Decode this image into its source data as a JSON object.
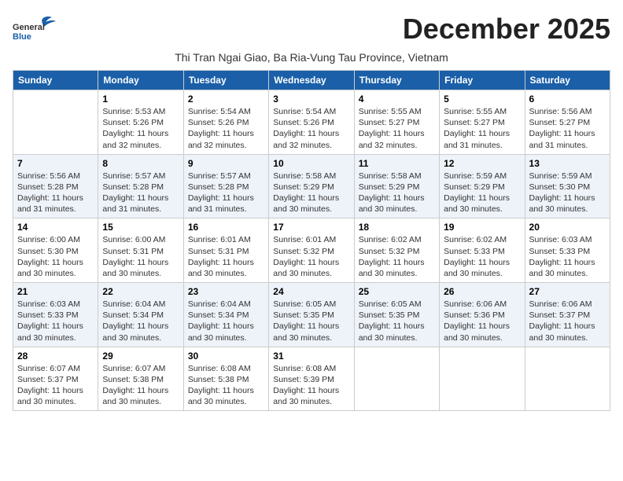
{
  "header": {
    "logo_general": "General",
    "logo_blue": "Blue",
    "month_title": "December 2025",
    "subtitle": "Thi Tran Ngai Giao, Ba Ria-Vung Tau Province, Vietnam"
  },
  "weekdays": [
    "Sunday",
    "Monday",
    "Tuesday",
    "Wednesday",
    "Thursday",
    "Friday",
    "Saturday"
  ],
  "weeks": [
    [
      {
        "day": "",
        "info": ""
      },
      {
        "day": "1",
        "info": "Sunrise: 5:53 AM\nSunset: 5:26 PM\nDaylight: 11 hours\nand 32 minutes."
      },
      {
        "day": "2",
        "info": "Sunrise: 5:54 AM\nSunset: 5:26 PM\nDaylight: 11 hours\nand 32 minutes."
      },
      {
        "day": "3",
        "info": "Sunrise: 5:54 AM\nSunset: 5:26 PM\nDaylight: 11 hours\nand 32 minutes."
      },
      {
        "day": "4",
        "info": "Sunrise: 5:55 AM\nSunset: 5:27 PM\nDaylight: 11 hours\nand 32 minutes."
      },
      {
        "day": "5",
        "info": "Sunrise: 5:55 AM\nSunset: 5:27 PM\nDaylight: 11 hours\nand 31 minutes."
      },
      {
        "day": "6",
        "info": "Sunrise: 5:56 AM\nSunset: 5:27 PM\nDaylight: 11 hours\nand 31 minutes."
      }
    ],
    [
      {
        "day": "7",
        "info": "Sunrise: 5:56 AM\nSunset: 5:28 PM\nDaylight: 11 hours\nand 31 minutes."
      },
      {
        "day": "8",
        "info": "Sunrise: 5:57 AM\nSunset: 5:28 PM\nDaylight: 11 hours\nand 31 minutes."
      },
      {
        "day": "9",
        "info": "Sunrise: 5:57 AM\nSunset: 5:28 PM\nDaylight: 11 hours\nand 31 minutes."
      },
      {
        "day": "10",
        "info": "Sunrise: 5:58 AM\nSunset: 5:29 PM\nDaylight: 11 hours\nand 30 minutes."
      },
      {
        "day": "11",
        "info": "Sunrise: 5:58 AM\nSunset: 5:29 PM\nDaylight: 11 hours\nand 30 minutes."
      },
      {
        "day": "12",
        "info": "Sunrise: 5:59 AM\nSunset: 5:29 PM\nDaylight: 11 hours\nand 30 minutes."
      },
      {
        "day": "13",
        "info": "Sunrise: 5:59 AM\nSunset: 5:30 PM\nDaylight: 11 hours\nand 30 minutes."
      }
    ],
    [
      {
        "day": "14",
        "info": "Sunrise: 6:00 AM\nSunset: 5:30 PM\nDaylight: 11 hours\nand 30 minutes."
      },
      {
        "day": "15",
        "info": "Sunrise: 6:00 AM\nSunset: 5:31 PM\nDaylight: 11 hours\nand 30 minutes."
      },
      {
        "day": "16",
        "info": "Sunrise: 6:01 AM\nSunset: 5:31 PM\nDaylight: 11 hours\nand 30 minutes."
      },
      {
        "day": "17",
        "info": "Sunrise: 6:01 AM\nSunset: 5:32 PM\nDaylight: 11 hours\nand 30 minutes."
      },
      {
        "day": "18",
        "info": "Sunrise: 6:02 AM\nSunset: 5:32 PM\nDaylight: 11 hours\nand 30 minutes."
      },
      {
        "day": "19",
        "info": "Sunrise: 6:02 AM\nSunset: 5:33 PM\nDaylight: 11 hours\nand 30 minutes."
      },
      {
        "day": "20",
        "info": "Sunrise: 6:03 AM\nSunset: 5:33 PM\nDaylight: 11 hours\nand 30 minutes."
      }
    ],
    [
      {
        "day": "21",
        "info": "Sunrise: 6:03 AM\nSunset: 5:33 PM\nDaylight: 11 hours\nand 30 minutes."
      },
      {
        "day": "22",
        "info": "Sunrise: 6:04 AM\nSunset: 5:34 PM\nDaylight: 11 hours\nand 30 minutes."
      },
      {
        "day": "23",
        "info": "Sunrise: 6:04 AM\nSunset: 5:34 PM\nDaylight: 11 hours\nand 30 minutes."
      },
      {
        "day": "24",
        "info": "Sunrise: 6:05 AM\nSunset: 5:35 PM\nDaylight: 11 hours\nand 30 minutes."
      },
      {
        "day": "25",
        "info": "Sunrise: 6:05 AM\nSunset: 5:35 PM\nDaylight: 11 hours\nand 30 minutes."
      },
      {
        "day": "26",
        "info": "Sunrise: 6:06 AM\nSunset: 5:36 PM\nDaylight: 11 hours\nand 30 minutes."
      },
      {
        "day": "27",
        "info": "Sunrise: 6:06 AM\nSunset: 5:37 PM\nDaylight: 11 hours\nand 30 minutes."
      }
    ],
    [
      {
        "day": "28",
        "info": "Sunrise: 6:07 AM\nSunset: 5:37 PM\nDaylight: 11 hours\nand 30 minutes."
      },
      {
        "day": "29",
        "info": "Sunrise: 6:07 AM\nSunset: 5:38 PM\nDaylight: 11 hours\nand 30 minutes."
      },
      {
        "day": "30",
        "info": "Sunrise: 6:08 AM\nSunset: 5:38 PM\nDaylight: 11 hours\nand 30 minutes."
      },
      {
        "day": "31",
        "info": "Sunrise: 6:08 AM\nSunset: 5:39 PM\nDaylight: 11 hours\nand 30 minutes."
      },
      {
        "day": "",
        "info": ""
      },
      {
        "day": "",
        "info": ""
      },
      {
        "day": "",
        "info": ""
      }
    ]
  ]
}
